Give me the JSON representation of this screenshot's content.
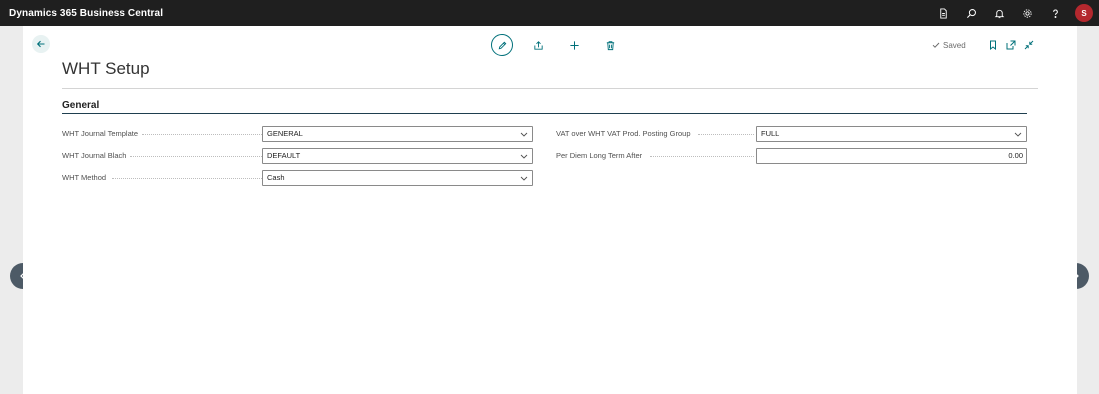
{
  "topbar": {
    "app_title": "Dynamics 365 Business Central",
    "icons": [
      "document-icon",
      "search-icon",
      "bell-icon",
      "gear-icon",
      "help-icon"
    ],
    "avatar_initial": "S"
  },
  "page": {
    "title": "WHT Setup",
    "saved_label": "Saved"
  },
  "general": {
    "section_title": "General",
    "wht_journal_template": {
      "label": "WHT Journal Template",
      "value": "GENERAL"
    },
    "wht_journal_batch": {
      "label": "WHT Journal Blach",
      "value": "DEFAULT"
    },
    "wht_method": {
      "label": "WHT Method",
      "value": "Cash"
    },
    "vat_over_wht": {
      "label": "VAT over WHT VAT Prod. Posting Group",
      "value": "FULL"
    },
    "per_diem": {
      "label": "Per Diem Long Term After",
      "value": "0.00"
    }
  },
  "colors": {
    "topbar_bg": "#1f1f1f",
    "accent": "#00707a",
    "avatar": "#b4282e",
    "nav_circle": "#4d5a66"
  }
}
